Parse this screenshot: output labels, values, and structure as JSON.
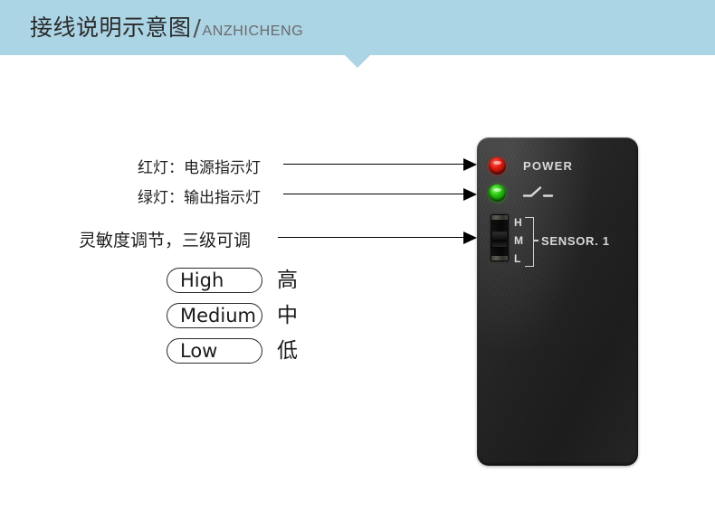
{
  "header": {
    "title_cn": "接线说明示意图",
    "separator": "/",
    "title_en": "ANZHICHENG",
    "background_color": "#abd4e5"
  },
  "annotations": [
    {
      "id": "red-led",
      "text": "红灯：电源指示灯"
    },
    {
      "id": "green-led",
      "text": "绿灯：输出指示灯"
    },
    {
      "id": "sensitivity",
      "text": "灵敏度调节，三级可调"
    }
  ],
  "legend": {
    "rows": [
      {
        "en": "High",
        "cn": "高"
      },
      {
        "en": "Medium",
        "cn": "中"
      },
      {
        "en": "Low",
        "cn": "低"
      }
    ]
  },
  "device": {
    "power_label": "POWER",
    "relay_icon": "relay-contact-symbol",
    "sensor_label": "SENSOR. 1",
    "switch_positions": [
      "H",
      "M",
      "L"
    ],
    "leds": [
      {
        "name": "power-led",
        "color": "#e01b10"
      },
      {
        "name": "output-led",
        "color": "#27c20e"
      }
    ],
    "body_color": "#212121"
  }
}
